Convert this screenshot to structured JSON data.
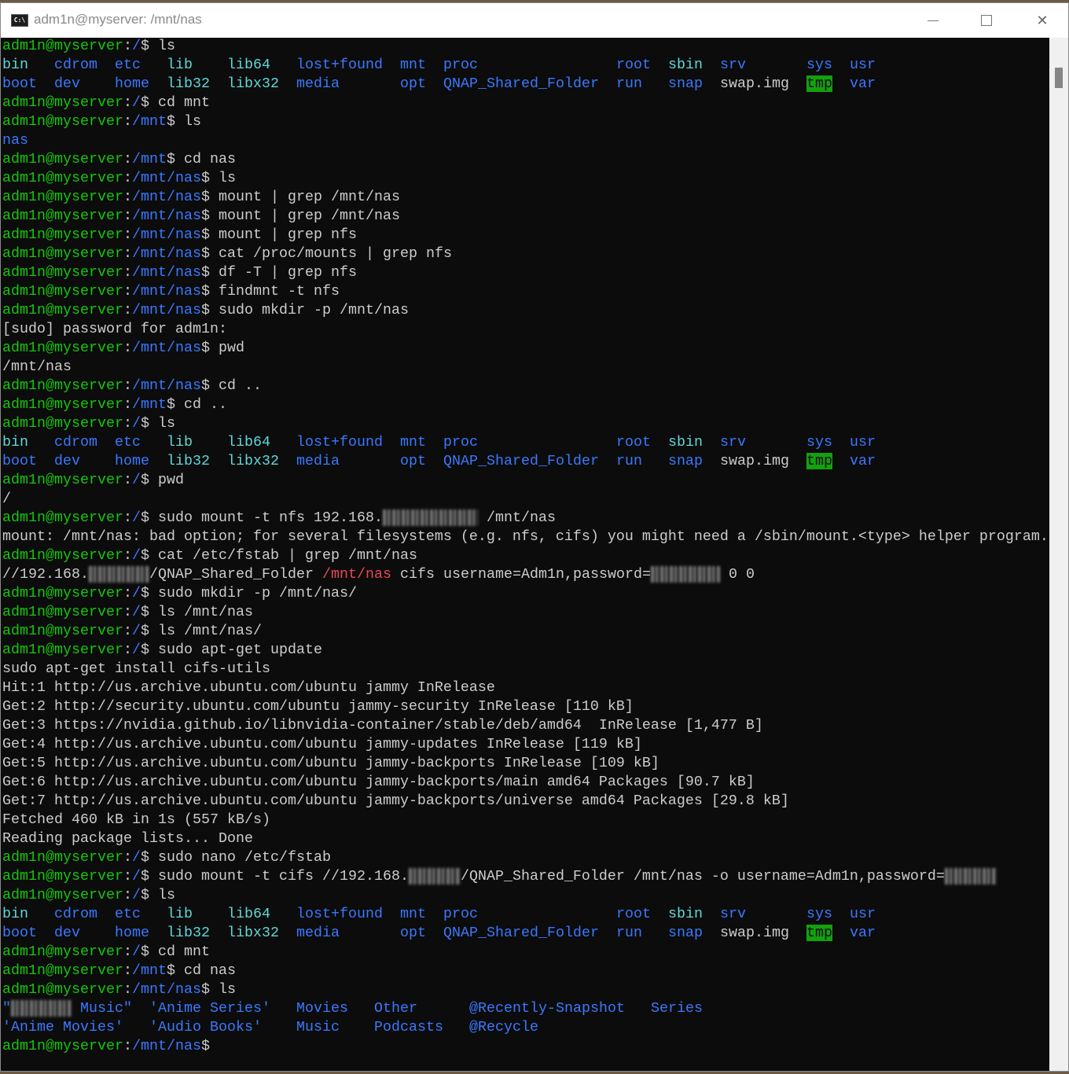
{
  "window": {
    "title": "adm1n@myserver: /mnt/nas",
    "icon": "terminal-icon",
    "minimize": "minimize-icon",
    "maximize": "maximize-icon",
    "close": "✕"
  },
  "colors": {
    "background": "#0c0c0c",
    "prompt_user": "#16c60c",
    "path": "#3b78ff",
    "symlink": "#61d6d6",
    "text": "#cccccc",
    "red": "#e74856",
    "sticky_dir_bg": "#13a10e"
  },
  "terminal": {
    "user": "adm1n@myserver",
    "sep": ":",
    "suffix": "$ ",
    "lines": [
      {
        "prompt": "/",
        "cmd": "ls"
      },
      {
        "seg": [
          [
            "bin   ",
            "c"
          ],
          [
            "cdrom  ",
            "b"
          ],
          [
            "etc   ",
            "b"
          ],
          [
            "lib    ",
            "c"
          ],
          [
            "lib64   ",
            "c"
          ],
          [
            "lost+found  ",
            "b"
          ],
          [
            "mnt  ",
            "b"
          ],
          [
            "proc                ",
            "b"
          ],
          [
            "root  ",
            "b"
          ],
          [
            "sbin  ",
            "c"
          ],
          [
            "srv       ",
            "b"
          ],
          [
            "sys  ",
            "b"
          ],
          [
            "usr",
            "b"
          ]
        ]
      },
      {
        "seg": [
          [
            "boot  ",
            "b"
          ],
          [
            "dev    ",
            "b"
          ],
          [
            "home  ",
            "b"
          ],
          [
            "lib32  ",
            "c"
          ],
          [
            "libx32  ",
            "c"
          ],
          [
            "media       ",
            "b"
          ],
          [
            "opt  ",
            "b"
          ],
          [
            "QNAP_Shared_Folder  ",
            "b"
          ],
          [
            "run   ",
            "b"
          ],
          [
            "snap  ",
            "b"
          ],
          [
            "swap.img  ",
            "w"
          ],
          [
            "tmp",
            "t"
          ],
          [
            "  ",
            "w"
          ],
          [
            "var",
            "b"
          ]
        ]
      },
      {
        "prompt": "/",
        "cmd": "cd mnt"
      },
      {
        "prompt": "/mnt",
        "cmd": "ls"
      },
      {
        "seg": [
          [
            "nas",
            "b"
          ]
        ]
      },
      {
        "prompt": "/mnt",
        "cmd": "cd nas"
      },
      {
        "prompt": "/mnt/nas",
        "cmd": "ls"
      },
      {
        "prompt": "/mnt/nas",
        "cmd": "mount | grep /mnt/nas"
      },
      {
        "prompt": "/mnt/nas",
        "cmd": "mount | grep /mnt/nas"
      },
      {
        "prompt": "/mnt/nas",
        "cmd": "mount | grep nfs"
      },
      {
        "prompt": "/mnt/nas",
        "cmd": "cat /proc/mounts | grep nfs"
      },
      {
        "prompt": "/mnt/nas",
        "cmd": "df -T | grep nfs"
      },
      {
        "prompt": "/mnt/nas",
        "cmd": "findmnt -t nfs"
      },
      {
        "prompt": "/mnt/nas",
        "cmd": "sudo mkdir -p /mnt/nas"
      },
      {
        "seg": [
          [
            "[sudo] password for adm1n:",
            "w"
          ]
        ]
      },
      {
        "prompt": "/mnt/nas",
        "cmd": "pwd"
      },
      {
        "seg": [
          [
            "/mnt/nas",
            "w"
          ]
        ]
      },
      {
        "prompt": "/mnt/nas",
        "cmd": "cd .."
      },
      {
        "prompt": "/mnt",
        "cmd": "cd .."
      },
      {
        "prompt": "/",
        "cmd": "ls"
      },
      {
        "seg": [
          [
            "bin   ",
            "c"
          ],
          [
            "cdrom  ",
            "b"
          ],
          [
            "etc   ",
            "b"
          ],
          [
            "lib    ",
            "c"
          ],
          [
            "lib64   ",
            "c"
          ],
          [
            "lost+found  ",
            "b"
          ],
          [
            "mnt  ",
            "b"
          ],
          [
            "proc                ",
            "b"
          ],
          [
            "root  ",
            "b"
          ],
          [
            "sbin  ",
            "c"
          ],
          [
            "srv       ",
            "b"
          ],
          [
            "sys  ",
            "b"
          ],
          [
            "usr",
            "b"
          ]
        ]
      },
      {
        "seg": [
          [
            "boot  ",
            "b"
          ],
          [
            "dev    ",
            "b"
          ],
          [
            "home  ",
            "b"
          ],
          [
            "lib32  ",
            "c"
          ],
          [
            "libx32  ",
            "c"
          ],
          [
            "media       ",
            "b"
          ],
          [
            "opt  ",
            "b"
          ],
          [
            "QNAP_Shared_Folder  ",
            "b"
          ],
          [
            "run   ",
            "b"
          ],
          [
            "snap  ",
            "b"
          ],
          [
            "swap.img  ",
            "w"
          ],
          [
            "tmp",
            "t"
          ],
          [
            "  ",
            "w"
          ],
          [
            "var",
            "b"
          ]
        ]
      },
      {
        "prompt": "/",
        "cmd": "pwd"
      },
      {
        "seg": [
          [
            "/",
            "w"
          ]
        ]
      },
      {
        "prompt": "/",
        "cmd": "sudo mount -t nfs 192.168.",
        "more": [
          [
            "           ",
            "x"
          ],
          [
            " /mnt/nas",
            "w"
          ]
        ]
      },
      {
        "seg": [
          [
            "mount: /mnt/nas: bad option; for several filesystems (e.g. nfs, cifs) you might need a /sbin/mount.<type> helper program.",
            "w"
          ]
        ]
      },
      {
        "prompt": "/",
        "cmd": "cat /etc/fstab | grep /mnt/nas"
      },
      {
        "seg": [
          [
            "//192.168.",
            "w"
          ],
          [
            "       ",
            "x"
          ],
          [
            "/QNAP_Shared_Folder ",
            "w"
          ],
          [
            "/mnt/nas",
            "r"
          ],
          [
            " cifs username=Adm1n,password=",
            "w"
          ],
          [
            "        ",
            "x"
          ],
          [
            " 0 0",
            "w"
          ]
        ]
      },
      {
        "prompt": "/",
        "cmd": "sudo mkdir -p /mnt/nas/"
      },
      {
        "prompt": "/",
        "cmd": "ls /mnt/nas"
      },
      {
        "prompt": "/",
        "cmd": "ls /mnt/nas/"
      },
      {
        "prompt": "/",
        "cmd": "sudo apt-get update"
      },
      {
        "seg": [
          [
            "sudo apt-get install cifs-utils",
            "w"
          ]
        ]
      },
      {
        "seg": [
          [
            "Hit:1 http://us.archive.ubuntu.com/ubuntu jammy InRelease",
            "w"
          ]
        ]
      },
      {
        "seg": [
          [
            "Get:2 http://security.ubuntu.com/ubuntu jammy-security InRelease [110 kB]",
            "w"
          ]
        ]
      },
      {
        "seg": [
          [
            "Get:3 https://nvidia.github.io/libnvidia-container/stable/deb/amd64  InRelease [1,477 B]",
            "w"
          ]
        ]
      },
      {
        "seg": [
          [
            "Get:4 http://us.archive.ubuntu.com/ubuntu jammy-updates InRelease [119 kB]",
            "w"
          ]
        ]
      },
      {
        "seg": [
          [
            "Get:5 http://us.archive.ubuntu.com/ubuntu jammy-backports InRelease [109 kB]",
            "w"
          ]
        ]
      },
      {
        "seg": [
          [
            "Get:6 http://us.archive.ubuntu.com/ubuntu jammy-backports/main amd64 Packages [90.7 kB]",
            "w"
          ]
        ]
      },
      {
        "seg": [
          [
            "Get:7 http://us.archive.ubuntu.com/ubuntu jammy-backports/universe amd64 Packages [29.8 kB]",
            "w"
          ]
        ]
      },
      {
        "seg": [
          [
            "Fetched 460 kB in 1s (557 kB/s)",
            "w"
          ]
        ]
      },
      {
        "seg": [
          [
            "Reading package lists... Done",
            "w"
          ]
        ]
      },
      {
        "prompt": "/",
        "cmd": "sudo nano /etc/fstab"
      },
      {
        "prompt": "/",
        "cmd": "sudo mount -t cifs //192.168.",
        "more": [
          [
            "      ",
            "x"
          ],
          [
            "/QNAP_Shared_Folder /mnt/nas -o username=Adm1n,password=",
            "w"
          ],
          [
            "      ",
            "x"
          ]
        ]
      },
      {
        "prompt": "/",
        "cmd": "ls"
      },
      {
        "seg": [
          [
            "bin   ",
            "c"
          ],
          [
            "cdrom  ",
            "b"
          ],
          [
            "etc   ",
            "b"
          ],
          [
            "lib    ",
            "c"
          ],
          [
            "lib64   ",
            "c"
          ],
          [
            "lost+found  ",
            "b"
          ],
          [
            "mnt  ",
            "b"
          ],
          [
            "proc                ",
            "b"
          ],
          [
            "root  ",
            "b"
          ],
          [
            "sbin  ",
            "c"
          ],
          [
            "srv       ",
            "b"
          ],
          [
            "sys  ",
            "b"
          ],
          [
            "usr",
            "b"
          ]
        ]
      },
      {
        "seg": [
          [
            "boot  ",
            "b"
          ],
          [
            "dev    ",
            "b"
          ],
          [
            "home  ",
            "b"
          ],
          [
            "lib32  ",
            "c"
          ],
          [
            "libx32  ",
            "c"
          ],
          [
            "media       ",
            "b"
          ],
          [
            "opt  ",
            "b"
          ],
          [
            "QNAP_Shared_Folder  ",
            "b"
          ],
          [
            "run   ",
            "b"
          ],
          [
            "snap  ",
            "b"
          ],
          [
            "swap.img  ",
            "w"
          ],
          [
            "tmp",
            "t"
          ],
          [
            "  ",
            "w"
          ],
          [
            "var",
            "b"
          ]
        ]
      },
      {
        "prompt": "/",
        "cmd": "cd mnt"
      },
      {
        "prompt": "/mnt",
        "cmd": "cd nas"
      },
      {
        "prompt": "/mnt/nas",
        "cmd": "ls"
      },
      {
        "seg": [
          [
            "\"",
            "b"
          ],
          [
            "       ",
            "x"
          ],
          [
            " Music\"  ",
            "b"
          ],
          [
            "'Anime Series'   ",
            "b"
          ],
          [
            "Movies   ",
            "b"
          ],
          [
            "Other      ",
            "b"
          ],
          [
            "@Recently-Snapshot   ",
            "b"
          ],
          [
            "Series",
            "b"
          ]
        ]
      },
      {
        "seg": [
          [
            "'Anime Movies'   ",
            "b"
          ],
          [
            "'Audio Books'    ",
            "b"
          ],
          [
            "Music    ",
            "b"
          ],
          [
            "Podcasts   ",
            "b"
          ],
          [
            "@Recycle",
            "b"
          ]
        ]
      },
      {
        "prompt": "/mnt/nas",
        "cmd": ""
      }
    ]
  }
}
